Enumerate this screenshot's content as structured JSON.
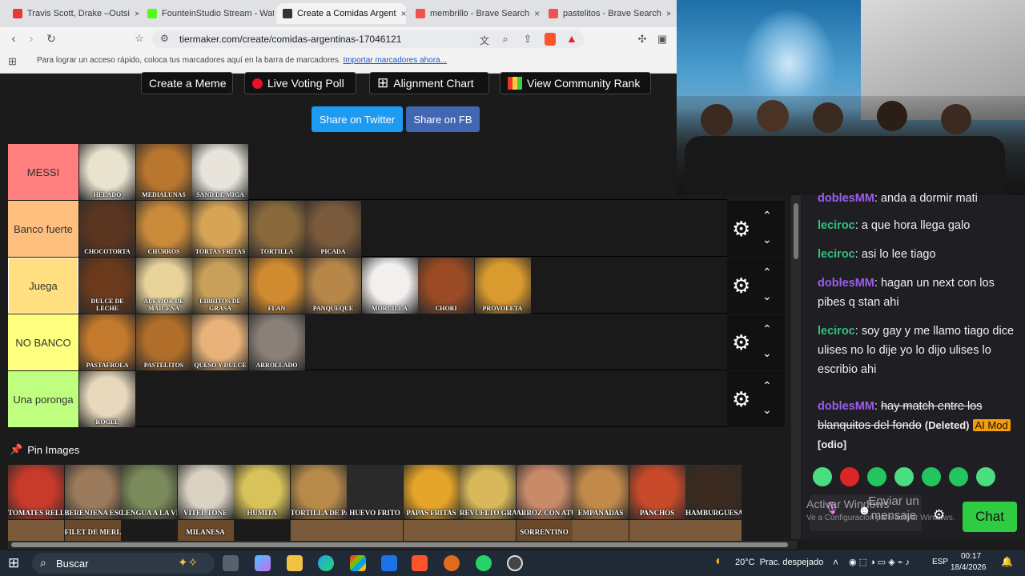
{
  "browser": {
    "tabs": [
      {
        "label": "Travis Scott, Drake –Outsi",
        "color": "#e53935"
      },
      {
        "label": "FounteinStudio Stream - Wat",
        "color": "#53fc18"
      },
      {
        "label": "Create a Comidas Argent",
        "color": "#333333"
      },
      {
        "label": "membrillo - Brave Search",
        "color": "#ef5350"
      },
      {
        "label": "pastelitos - Brave Search",
        "color": "#ef5350"
      }
    ],
    "url": "tiermaker.com/create/comidas-argentinas-17046121",
    "bookmarks_text": "Para lograr un acceso rápido, coloca tus marcadores aquí en la barra de marcadores.",
    "bookmarks_link": "Importar marcadores ahora..."
  },
  "page": {
    "buttons": [
      "Create a Meme",
      "Live Voting Poll",
      "Alignment Chart",
      "View Community Rank"
    ],
    "share_twitter": "Share on Twitter",
    "share_fb": "Share on FB",
    "tiers": [
      {
        "label": "MESSI",
        "color": "#ff7f7f",
        "items": [
          {
            "caption": "HELADO",
            "color": "#e9e2cf"
          },
          {
            "caption": "MEDIALUNAS",
            "color": "#b9762e"
          },
          {
            "caption": "SAND DE MIGA",
            "color": "#e8e4dc"
          }
        ]
      },
      {
        "label": "Banco fuerte",
        "color": "#ffbf7f",
        "items": [
          {
            "caption": "CHOCOTORTA",
            "color": "#5a3520"
          },
          {
            "caption": "CHURROS",
            "color": "#c98a3a"
          },
          {
            "caption": "TORTAS FRITAS",
            "color": "#d7a456"
          },
          {
            "caption": "TORTILLA",
            "color": "#8a6a3c"
          },
          {
            "caption": "PICADA",
            "color": "#7a5a3a"
          }
        ]
      },
      {
        "label": "Juega",
        "color": "#ffdf7f",
        "items": [
          {
            "caption": "DULCE DE LECHE",
            "color": "#6b3a1c"
          },
          {
            "caption": "ALFAJOR DE MAICENA",
            "color": "#e7d29a"
          },
          {
            "caption": "LIBRITOS DE GRASA",
            "color": "#c9a05a"
          },
          {
            "caption": "FLAN",
            "color": "#d08a30"
          },
          {
            "caption": "PANQUEQUE",
            "color": "#b7874a"
          },
          {
            "caption": "MORCILLA",
            "color": "#f2f0ee"
          },
          {
            "caption": "CHORI",
            "color": "#9a4a25"
          },
          {
            "caption": "PROVOLETA",
            "color": "#d99a2e"
          }
        ]
      },
      {
        "label": "NO BANCO",
        "color": "#ffff7f",
        "items": [
          {
            "caption": "PASTAFROLA",
            "color": "#c47a2c"
          },
          {
            "caption": "PASTELITOS",
            "color": "#b06e2a"
          },
          {
            "caption": "QUESO Y DULCE",
            "color": "#e9b27a"
          },
          {
            "caption": "ARROLLADO",
            "color": "#8a8078"
          }
        ]
      },
      {
        "label": "Una poronga",
        "color": "#bfff7f",
        "items": [
          {
            "caption": "ROGEL",
            "color": "#e8d9bd"
          }
        ]
      }
    ],
    "pin_label": "Pin Images",
    "pool": [
      {
        "caption": "TOMATES RELLENOS",
        "color": "#c83a2a"
      },
      {
        "caption": "BERENJENA ESCABECHE",
        "color": "#9a7a5a"
      },
      {
        "caption": "LENGUA A LA VINAGRETA",
        "color": "#7a8a5a"
      },
      {
        "caption": "VITEL TONE",
        "color": "#d9d2c2"
      },
      {
        "caption": "HUMITA",
        "color": "#d8c35a"
      },
      {
        "caption": "TORTILLA DE PAPAS",
        "color": "#b88a4a"
      },
      {
        "caption": "HUEVO FRITO",
        "color": "#2a2a2a"
      },
      {
        "caption": "PAPAS FRITAS",
        "color": "#e5a52a"
      },
      {
        "caption": "REVUELTO GRAMAJO",
        "color": "#d8b85a"
      },
      {
        "caption": "ARROZ CON ATÚN",
        "color": "#c98a6a"
      },
      {
        "caption": "EMPANADAS",
        "color": "#c28a4a"
      },
      {
        "caption": "PANCHOS",
        "color": "#c84a2a"
      },
      {
        "caption": "HAMBURGUESA",
        "color": "#3a2a1f"
      }
    ],
    "pool_row2": [
      "FILET DE MERLUZA",
      "MILANESA",
      "SORRENTINO"
    ]
  },
  "chat": {
    "messages": [
      {
        "user": "doblesMM",
        "cls": "u1",
        "text": "anda a dormir mati"
      },
      {
        "user": "leciroc",
        "cls": "u2",
        "text": "a que hora llega galo"
      },
      {
        "user": "leciroc",
        "cls": "u2",
        "text": "asi lo lee tiago"
      },
      {
        "user": "doblesMM",
        "cls": "u1",
        "text": "hagan un next con los pibes q stan ahi"
      },
      {
        "user": "leciroc",
        "cls": "u2",
        "text": "soy gay y me llamo tiago dice ulises no lo dije yo lo dijo ulises lo escribio ahi"
      },
      {
        "user": "doblesMM",
        "cls": "u1",
        "text": "hay match entre los blanquitos del fondo"
      }
    ],
    "deleted": "(Deleted)",
    "ai_mod": "AI Mod",
    "reason": "[odio]",
    "input_placeholder": "Enviar un mensaje",
    "chat_button": "Chat",
    "watermark_title": "Activar Windows",
    "watermark_sub": "Ve a Configuración para activar Windows."
  },
  "taskbar": {
    "search": "Buscar",
    "weather": "20°C  Prac. despejado",
    "lang": "ESP",
    "time": "00:17",
    "date": "18/4/2026"
  }
}
